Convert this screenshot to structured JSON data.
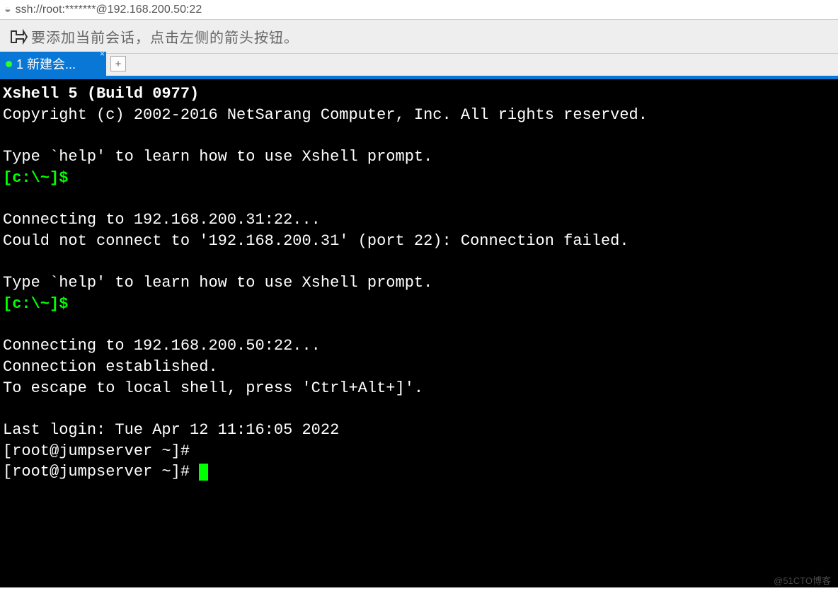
{
  "addressBar": {
    "url": "ssh://root:*******@192.168.200.50:22"
  },
  "infoBar": {
    "message": "要添加当前会话，点击左侧的箭头按钮。"
  },
  "tabs": {
    "active": {
      "label": "1 新建会...",
      "hasClose": true
    },
    "addTooltip": "+"
  },
  "terminal": {
    "banner1": "Xshell 5 (Build 0977)",
    "copyright": "Copyright (c) 2002-2016 NetSarang Computer, Inc. All rights reserved.",
    "helpLine": "Type `help' to learn how to use Xshell prompt.",
    "prompt": "[c:\\~]$",
    "connecting1": "Connecting to 192.168.200.31:22...",
    "failLine": "Could not connect to '192.168.200.31' (port 22): Connection failed.",
    "connecting2": "Connecting to 192.168.200.50:22...",
    "established": "Connection established.",
    "escape": "To escape to local shell, press 'Ctrl+Alt+]'.",
    "lastLogin": "Last login: Tue Apr 12 11:16:05 2022",
    "shellPrompt": "[root@jumpserver ~]#"
  },
  "watermark": "@51CTO博客"
}
